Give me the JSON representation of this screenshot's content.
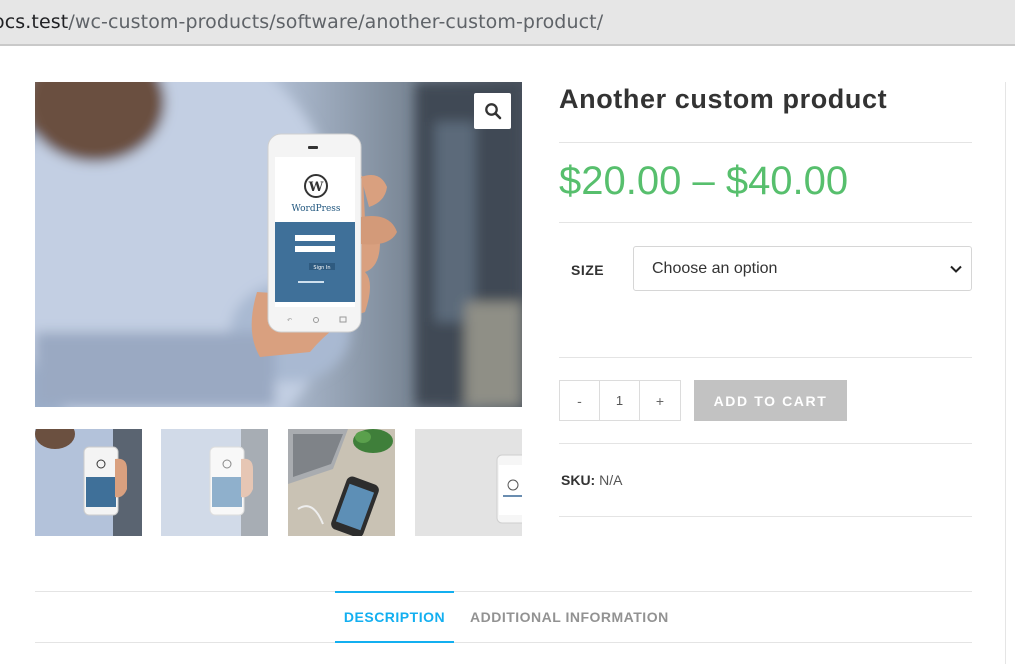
{
  "browser": {
    "url_host": "ocs.test",
    "url_path": "/wc-custom-products/software/another-custom-product/"
  },
  "product": {
    "title": "Another custom product",
    "price": "$20.00 – $40.00",
    "size_label": "SIZE",
    "size_select_value": "Choose an option",
    "quantity": "1",
    "qty_minus": "-",
    "qty_plus": "+",
    "add_to_cart": "ADD TO CART",
    "sku_label": "SKU:",
    "sku_value": "N/A"
  },
  "gallery": {
    "phone_brand": "WordPress",
    "login_button": "Sign In",
    "thumbnails": [
      "phone-in-hand",
      "phone-in-hand-faded",
      "desk-with-phone",
      "phone-corner"
    ]
  },
  "tabs": [
    {
      "label": "DESCRIPTION",
      "active": true
    },
    {
      "label": "ADDITIONAL INFORMATION",
      "active": false
    }
  ],
  "colors": {
    "price": "#57bf6d",
    "accent": "#13aff0",
    "cart_button": "#c2c2c2"
  }
}
